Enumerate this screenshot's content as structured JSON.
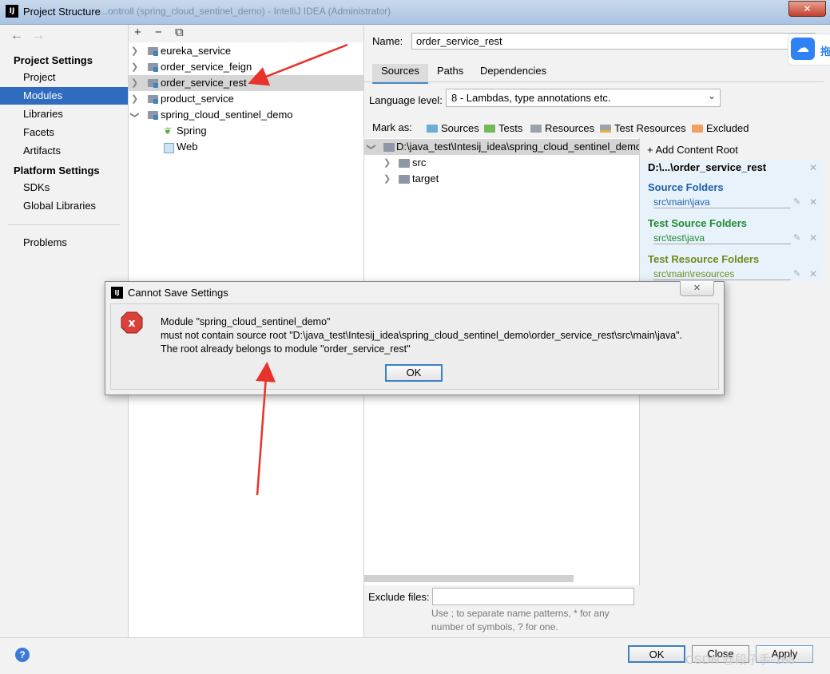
{
  "window": {
    "title": "Project Structure",
    "background_title": "...ontroll (spring_cloud_sentinel_demo) - IntelliJ IDEA (Administrator)",
    "close_label": "✕",
    "app_icon": "IJ"
  },
  "nav": {
    "project_settings_heading": "Project Settings",
    "project_items": [
      "Project",
      "Modules",
      "Libraries",
      "Facets",
      "Artifacts"
    ],
    "selected": "Modules",
    "platform_settings_heading": "Platform Settings",
    "platform_items": [
      "SDKs",
      "Global Libraries"
    ],
    "problems": "Problems"
  },
  "tree": {
    "toolbar": [
      "+",
      "−",
      "⧉"
    ],
    "modules": [
      {
        "label": "eureka_service",
        "expanded": false
      },
      {
        "label": "order_service_feign",
        "expanded": false
      },
      {
        "label": "order_service_rest",
        "expanded": false,
        "selected": true
      },
      {
        "label": "product_service",
        "expanded": false
      },
      {
        "label": "spring_cloud_sentinel_demo",
        "expanded": true
      }
    ],
    "children": [
      "Spring",
      "Web"
    ]
  },
  "module": {
    "name_label": "Name:",
    "name_value": "order_service_rest",
    "tabs": [
      "Sources",
      "Paths",
      "Dependencies"
    ],
    "active_tab": "Sources",
    "language_level_label": "Language level:",
    "language_level_value": "8 - Lambdas, type annotations etc.",
    "mark_as_label": "Mark as:",
    "mark_as": [
      {
        "label": "Sources",
        "color": "#6aaed6"
      },
      {
        "label": "Tests",
        "color": "#74b85c"
      },
      {
        "label": "Resources",
        "color": "#9aa3ad"
      },
      {
        "label": "Test Resources",
        "color": "#9aa3ad"
      },
      {
        "label": "Excluded",
        "color": "#f0a060"
      }
    ],
    "content_tree": {
      "root": "D:\\java_test\\Intesij_idea\\spring_cloud_sentinel_demo\\",
      "children": [
        "src",
        "target"
      ]
    },
    "add_content_root": "Add Content Root",
    "content_root": "D:\\...\\order_service_rest",
    "source_folders_label": "Source Folders",
    "source_folders": "src\\main\\java",
    "test_source_folders_label": "Test Source Folders",
    "test_source_folders": "src\\test\\java",
    "test_resource_folders_label": "Test Resource Folders",
    "test_resource_folders": "src\\main\\resources",
    "exclude_files_label": "Exclude files:",
    "exclude_files_value": "",
    "exclude_hint_1": "Use ; to separate name patterns, * for any",
    "exclude_hint_2": "number of symbols, ? for one."
  },
  "footer": {
    "help": "?",
    "ok": "OK",
    "cancel": "Close",
    "apply": "Apply",
    "watermark": "CSDN @段子手-168"
  },
  "cloud_widget": {
    "text": "拖"
  },
  "dialog": {
    "title": "Cannot Save Settings",
    "close_label": "✕",
    "line1": "Module \"spring_cloud_sentinel_demo\"",
    "line2": "must not contain source root \"D:\\java_test\\Intesij_idea\\spring_cloud_sentinel_demo\\order_service_rest\\src\\main\\java\".",
    "line3": "The root already belongs to module \"order_service_rest\"",
    "ok": "OK"
  },
  "colors": {
    "selection": "#2f6bbf",
    "source_label": "#1f5fa8",
    "test_source_label": "#1f8a2e",
    "test_resource_label": "#6f8a1a",
    "annotation_arrow": "#e8322a"
  }
}
